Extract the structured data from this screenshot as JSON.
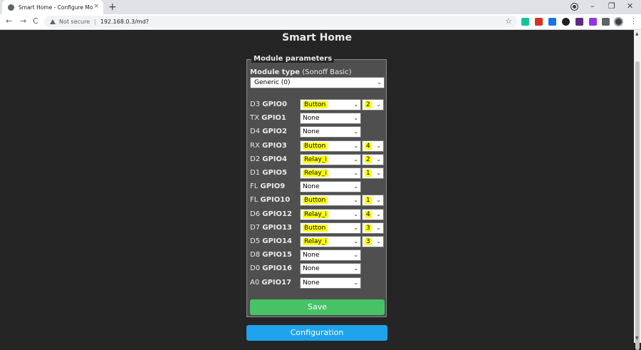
{
  "browser": {
    "tab_title": "Smart Home - Configure Module",
    "tab_close": "×",
    "new_tab": "+",
    "minimize": "–",
    "restore": "❐",
    "close": "✕",
    "back": "←",
    "forward": "→",
    "reload": "C",
    "security_label": "Not secure",
    "separator": "|",
    "url": "192.168.0.3/md?",
    "bookmark_star": "☆",
    "menu": "⋮",
    "extensions": [
      {
        "name": "grammarly-icon",
        "color": "#15c39a"
      },
      {
        "name": "pdf-extension-icon",
        "color": "#d93025"
      },
      {
        "name": "extension-blue-icon",
        "color": "#1a73e8"
      },
      {
        "name": "extension-dark-icon",
        "color": "#202124"
      },
      {
        "name": "extension-square-icon",
        "color": "#5f2a82"
      },
      {
        "name": "extension-purple-icon",
        "color": "#9334e6"
      },
      {
        "name": "puzzle-icon",
        "color": "#5f6368"
      }
    ]
  },
  "page": {
    "title": "Smart Home",
    "module_params": {
      "legend": "Module parameters",
      "module_type_label": "Module type",
      "module_type_value": "(Sonoff Basic)",
      "module_select": "Generic (0)",
      "rows": [
        {
          "pin": "D3",
          "gpio": "GPIO0",
          "value": "Button",
          "highlight": true,
          "index": "2"
        },
        {
          "pin": "TX",
          "gpio": "GPIO1",
          "value": "None",
          "highlight": false,
          "index": null
        },
        {
          "pin": "D4",
          "gpio": "GPIO2",
          "value": "None",
          "highlight": false,
          "index": null
        },
        {
          "pin": "RX",
          "gpio": "GPIO3",
          "value": "Button",
          "highlight": true,
          "index": "4"
        },
        {
          "pin": "D2",
          "gpio": "GPIO4",
          "value": "Relay_i",
          "highlight": true,
          "index": "2"
        },
        {
          "pin": "D1",
          "gpio": "GPIO5",
          "value": "Relay_i",
          "highlight": true,
          "index": "1"
        },
        {
          "pin": "FL",
          "gpio": "GPIO9",
          "value": "None",
          "highlight": false,
          "index": null
        },
        {
          "pin": "FL",
          "gpio": "GPIO10",
          "value": "Button",
          "highlight": true,
          "index": "1"
        },
        {
          "pin": "D6",
          "gpio": "GPIO12",
          "value": "Relay_i",
          "highlight": true,
          "index": "4"
        },
        {
          "pin": "D7",
          "gpio": "GPIO13",
          "value": "Button",
          "highlight": true,
          "index": "3"
        },
        {
          "pin": "D5",
          "gpio": "GPIO14",
          "value": "Relay_i",
          "highlight": true,
          "index": "3"
        },
        {
          "pin": "D8",
          "gpio": "GPIO15",
          "value": "None",
          "highlight": false,
          "index": null
        },
        {
          "pin": "D0",
          "gpio": "GPIO16",
          "value": "None",
          "highlight": false,
          "index": null
        },
        {
          "pin": "A0",
          "gpio": "GPIO17",
          "value": "None",
          "highlight": false,
          "index": null
        }
      ],
      "save_label": "Save"
    },
    "configuration_label": "Configuration"
  },
  "colors": {
    "background": "#252525",
    "save_button": "#47c266",
    "config_button": "#1fa3ec",
    "highlight": "#ffff00"
  }
}
